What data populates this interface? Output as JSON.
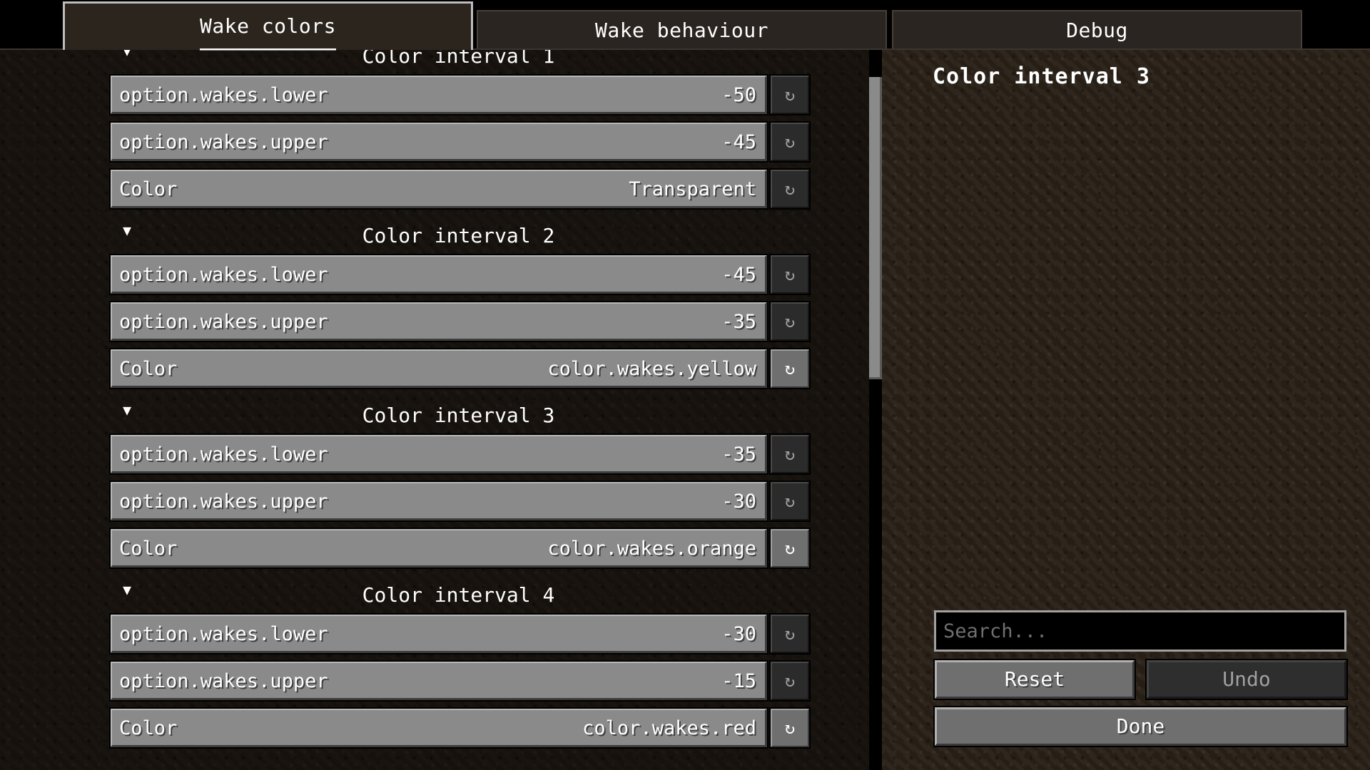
{
  "tabs": [
    {
      "label": "Wake colors",
      "active": true
    },
    {
      "label": "Wake behaviour",
      "active": false
    },
    {
      "label": "Debug",
      "active": false
    }
  ],
  "groups": [
    {
      "title": "Color interval 1",
      "rows": [
        {
          "label": "option.wakes.lower",
          "value": "-50",
          "reset_enabled": false
        },
        {
          "label": "option.wakes.upper",
          "value": "-45",
          "reset_enabled": false
        },
        {
          "label": "Color",
          "value": "Transparent",
          "reset_enabled": false
        }
      ]
    },
    {
      "title": "Color interval 2",
      "rows": [
        {
          "label": "option.wakes.lower",
          "value": "-45",
          "reset_enabled": false
        },
        {
          "label": "option.wakes.upper",
          "value": "-35",
          "reset_enabled": false
        },
        {
          "label": "Color",
          "value": "color.wakes.yellow",
          "reset_enabled": true
        }
      ]
    },
    {
      "title": "Color interval 3",
      "rows": [
        {
          "label": "option.wakes.lower",
          "value": "-35",
          "reset_enabled": false
        },
        {
          "label": "option.wakes.upper",
          "value": "-30",
          "reset_enabled": false
        },
        {
          "label": "Color",
          "value": "color.wakes.orange",
          "reset_enabled": true
        }
      ]
    },
    {
      "title": "Color interval 4",
      "rows": [
        {
          "label": "option.wakes.lower",
          "value": "-30",
          "reset_enabled": false
        },
        {
          "label": "option.wakes.upper",
          "value": "-15",
          "reset_enabled": false
        },
        {
          "label": "Color",
          "value": "color.wakes.red",
          "reset_enabled": true
        }
      ]
    }
  ],
  "icons": {
    "collapse": "▼",
    "reset": "↻"
  },
  "side_panel": {
    "title": "Color interval 3",
    "search_placeholder": "Search...",
    "reset_label": "Reset",
    "undo_label": "Undo",
    "done_label": "Done"
  },
  "colors": {
    "button_face": "#6f6f6f",
    "button_disabled": "#2e2e2e",
    "background": "#2b2219"
  }
}
